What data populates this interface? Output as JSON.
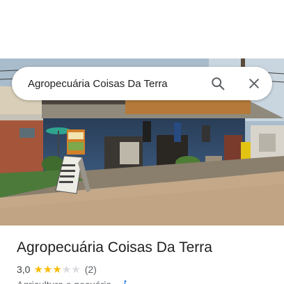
{
  "search": {
    "query": "Agropecuária Coisas Da Terra",
    "search_icon": "search-icon",
    "close_icon": "close-icon"
  },
  "photo": {
    "shop_sign_text": "",
    "stand_sign_text": ""
  },
  "place": {
    "name": "Agropecuária Coisas Da Terra",
    "rating": "3,0",
    "stars": 3,
    "max_stars": 5,
    "review_count": "(2)",
    "category": "Agricultura e pecuária",
    "separator": "·",
    "accessibility_icon": "wheelchair-icon"
  },
  "colors": {
    "star_filled": "#fbbc04",
    "star_empty": "#dadce0",
    "accessibility_blue": "#1a73e8",
    "text_primary": "#202124",
    "text_secondary": "#5f6368"
  }
}
